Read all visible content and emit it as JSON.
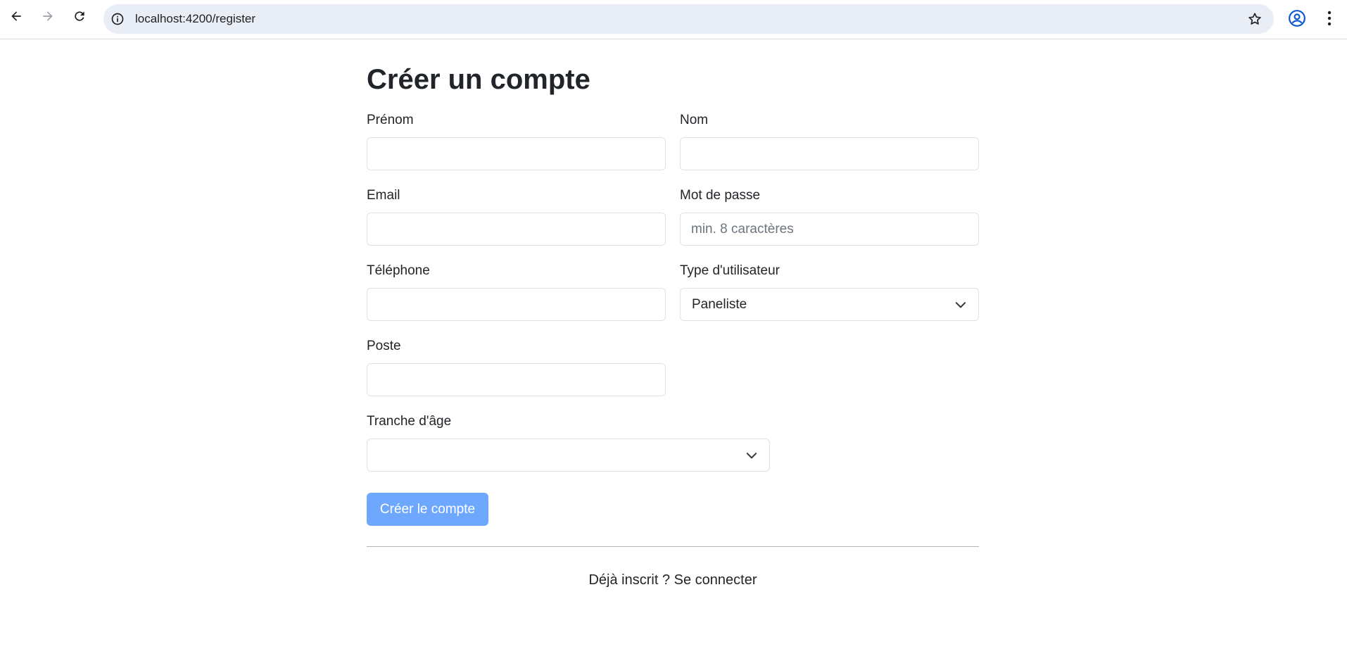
{
  "browser": {
    "url": "localhost:4200/register",
    "icons": {
      "back": "arrow-left-icon",
      "forward": "arrow-right-icon",
      "reload": "reload-icon",
      "site_info": "info-icon",
      "bookmark": "star-icon",
      "profile": "account-icon",
      "menu": "more-vert-icon"
    }
  },
  "form": {
    "title": "Créer un compte",
    "fields": {
      "first_name": {
        "label": "Prénom",
        "value": "",
        "placeholder": ""
      },
      "last_name": {
        "label": "Nom",
        "value": "",
        "placeholder": ""
      },
      "email": {
        "label": "Email",
        "value": "",
        "placeholder": ""
      },
      "password": {
        "label": "Mot de passe",
        "value": "",
        "placeholder": "min. 8 caractères"
      },
      "phone": {
        "label": "Téléphone",
        "value": "",
        "placeholder": ""
      },
      "user_type": {
        "label": "Type d'utilisateur",
        "selected": "Paneliste"
      },
      "position": {
        "label": "Poste",
        "value": "",
        "placeholder": ""
      },
      "age_range": {
        "label": "Tranche d'âge",
        "selected": ""
      }
    },
    "submit_label": "Créer le compte",
    "footer_prefix": "Déjà inscrit ?",
    "footer_link": "Se connecter"
  },
  "colors": {
    "primary_disabled": "#6ea8fe",
    "text": "#212529",
    "border": "#dee2e6",
    "omnibox": "#e9eef6",
    "profile_icon": "#0b57d0"
  }
}
